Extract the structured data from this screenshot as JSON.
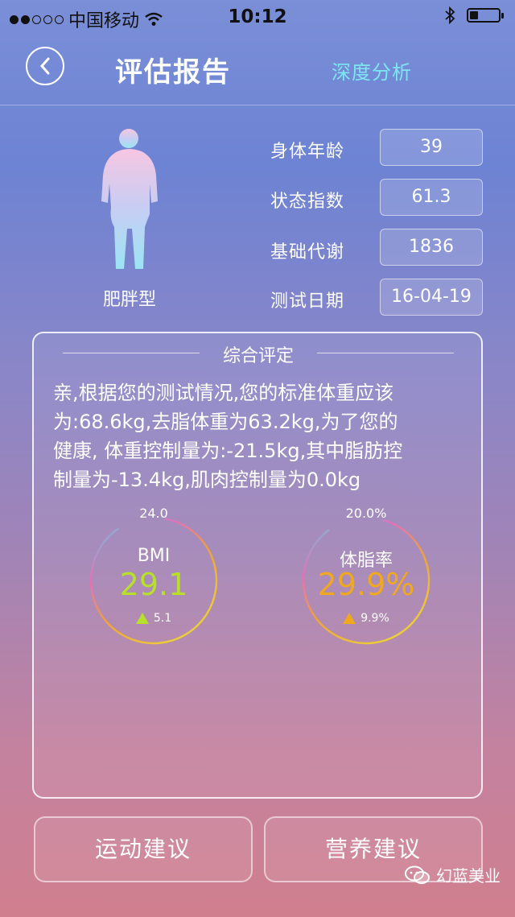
{
  "status_bar": {
    "carrier": "中国移动",
    "time": "10:12"
  },
  "nav": {
    "title": "评估报告",
    "deep_analysis": "深度分析"
  },
  "profile": {
    "body_type": "肥胖型",
    "metrics": [
      {
        "label": "身体年龄",
        "value": "39"
      },
      {
        "label": "状态指数",
        "value": "61.3"
      },
      {
        "label": "基础代谢",
        "value": "1836"
      },
      {
        "label": "测试日期",
        "value": "16-04-19"
      }
    ]
  },
  "summary": {
    "title": "综合评定",
    "lines": [
      "亲,根据您的测试情况,您的标准体重应该",
      "为:68.6kg,去脂体重为63.2kg,为了您的",
      "健康, 体重控制量为:-21.5kg,其中脂肪控",
      "制量为-13.4kg,肌肉控制量为0.0kg"
    ]
  },
  "gauges": {
    "bmi": {
      "standard": "24.0",
      "name": "BMI",
      "value": "29.1",
      "delta": "5.1",
      "color": "#b6e02a"
    },
    "body_fat": {
      "standard": "20.0%",
      "name": "体脂率",
      "value": "29.9%",
      "delta": "9.9%",
      "color": "#f0a81e"
    }
  },
  "buttons": {
    "exercise": "运动建议",
    "nutrition": "营养建议"
  },
  "watermark": "幻蓝美业"
}
